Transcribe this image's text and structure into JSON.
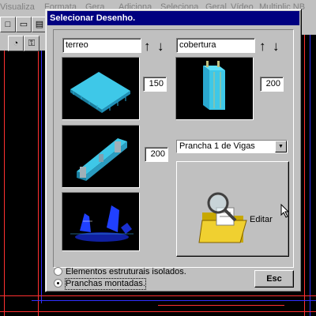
{
  "app": {
    "menu": [
      "Visualiza",
      "Formata",
      "Gera",
      "Adiciona",
      "Seleciona",
      "Geral",
      "Vídeo",
      "Multiplic NB"
    ]
  },
  "dialog": {
    "title": "Selecionar Desenho.",
    "close_label": "×",
    "left_field": {
      "value": "terreo"
    },
    "right_field": {
      "value": "cobertura"
    },
    "sort_up_label": "↑",
    "sort_down_label": "↓",
    "scale_1": "150",
    "scale_2": "200",
    "scale_3": "200",
    "prancha_select": {
      "selected": "Prancha  1 de Vigas"
    },
    "edit_button_label": "Editar",
    "radio_options": [
      {
        "label": "Elementos estruturais isolados.",
        "checked": false
      },
      {
        "label": "Pranchas montadas.",
        "checked": true
      }
    ],
    "esc_label": "Esc"
  },
  "colors": {
    "titlebar": "#000080",
    "dialog_face": "#c0c0c0",
    "model_cyan": "#3ec8e8",
    "model_blue": "#2040ff"
  }
}
